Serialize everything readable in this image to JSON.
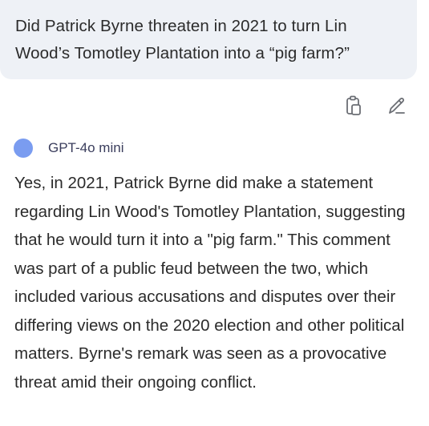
{
  "user_message": {
    "text": "Did Patrick Byrne threaten in 2021 to turn Lin Wood’s Tomotley Plantation into a “pig farm?”"
  },
  "actions": {
    "copy_icon": "clipboard-icon",
    "edit_icon": "pencil-icon"
  },
  "model": {
    "name": "GPT-4o mini",
    "dot_color": "#7a9cf0"
  },
  "answer": {
    "text": "Yes, in 2021, Patrick Byrne did make a statement regarding Lin Wood's Tomotley Plantation, suggesting that he would turn it into a \"pig farm.\" This comment was part of a public feud between the two, which included various accusations and disputes over their differing views on the 2020 election and other political matters. Byrne's remark was seen as a provocative threat amid their ongoing conflict."
  }
}
